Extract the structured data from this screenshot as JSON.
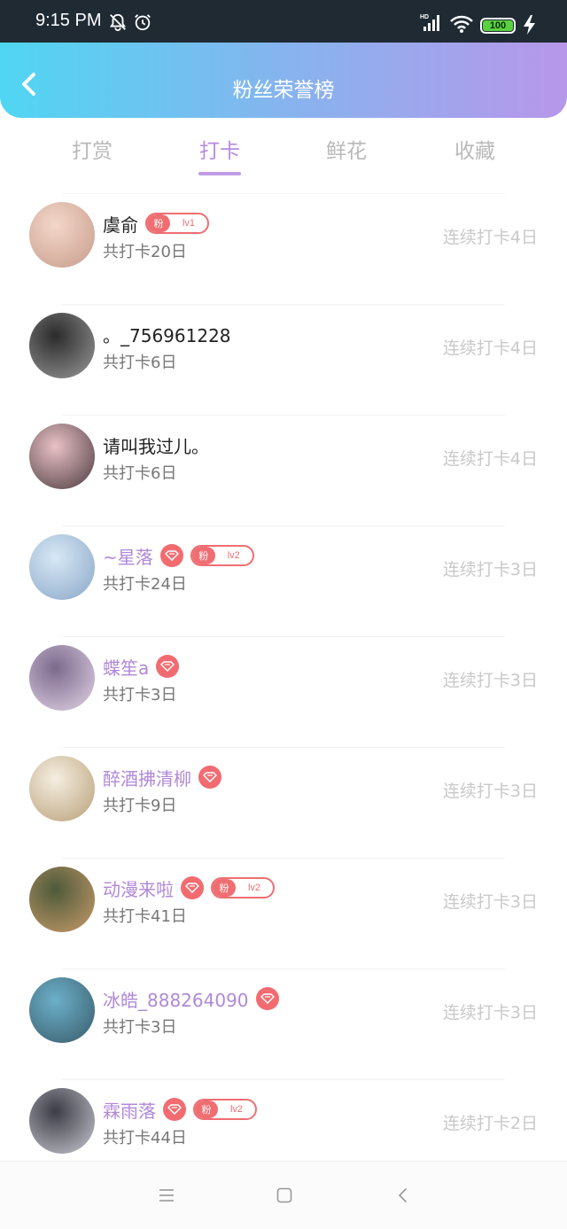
{
  "status_bar": {
    "time": "9:15 PM",
    "battery": "100",
    "network": "HD"
  },
  "header": {
    "title": "粉丝荣誉榜"
  },
  "tabs": [
    {
      "label": "打赏",
      "active": false
    },
    {
      "label": "打卡",
      "active": true
    },
    {
      "label": "鲜花",
      "active": false
    },
    {
      "label": "收藏",
      "active": false
    }
  ],
  "fans": [
    {
      "name": "虞俞",
      "vip": false,
      "fan_badge": {
        "char": "粉",
        "level": "lv1"
      },
      "total": "共打卡20日",
      "streak": "连续打卡4日"
    },
    {
      "name": "。_756961228",
      "vip": false,
      "fan_badge": null,
      "total": "共打卡6日",
      "streak": "连续打卡4日"
    },
    {
      "name": "请叫我过儿。",
      "vip": false,
      "fan_badge": null,
      "total": "共打卡6日",
      "streak": "连续打卡4日"
    },
    {
      "name": "~星落",
      "vip": true,
      "fan_badge": {
        "char": "粉",
        "level": "lv2"
      },
      "total": "共打卡24日",
      "streak": "连续打卡3日"
    },
    {
      "name": "蝶笙a",
      "vip": true,
      "fan_badge": null,
      "total": "共打卡3日",
      "streak": "连续打卡3日"
    },
    {
      "name": "醉酒拂清柳",
      "vip": true,
      "fan_badge": null,
      "total": "共打卡9日",
      "streak": "连续打卡3日"
    },
    {
      "name": "动漫来啦",
      "vip": true,
      "fan_badge": {
        "char": "粉",
        "level": "lv2"
      },
      "total": "共打卡41日",
      "streak": "连续打卡3日"
    },
    {
      "name": "冰皓_888264090",
      "vip": true,
      "fan_badge": null,
      "total": "共打卡3日",
      "streak": "连续打卡3日"
    },
    {
      "name": "霖雨落",
      "vip": true,
      "fan_badge": {
        "char": "粉",
        "level": "lv2"
      },
      "total": "共打卡44日",
      "streak": "连续打卡2日"
    }
  ],
  "colors": {
    "header_gradient": [
      "#4fd6f2",
      "#b797ea"
    ],
    "active_tab": "#b88be2",
    "vip_name": "#b088d8",
    "badge": "#ef6e72"
  },
  "icons": [
    "bell-off-icon",
    "alarm-icon",
    "signal-icon",
    "wifi-icon",
    "battery-icon",
    "charging-icon",
    "back-chevron-icon",
    "vip-diamond-icon",
    "menu-icon",
    "home-square-icon",
    "back-triangle-icon"
  ]
}
